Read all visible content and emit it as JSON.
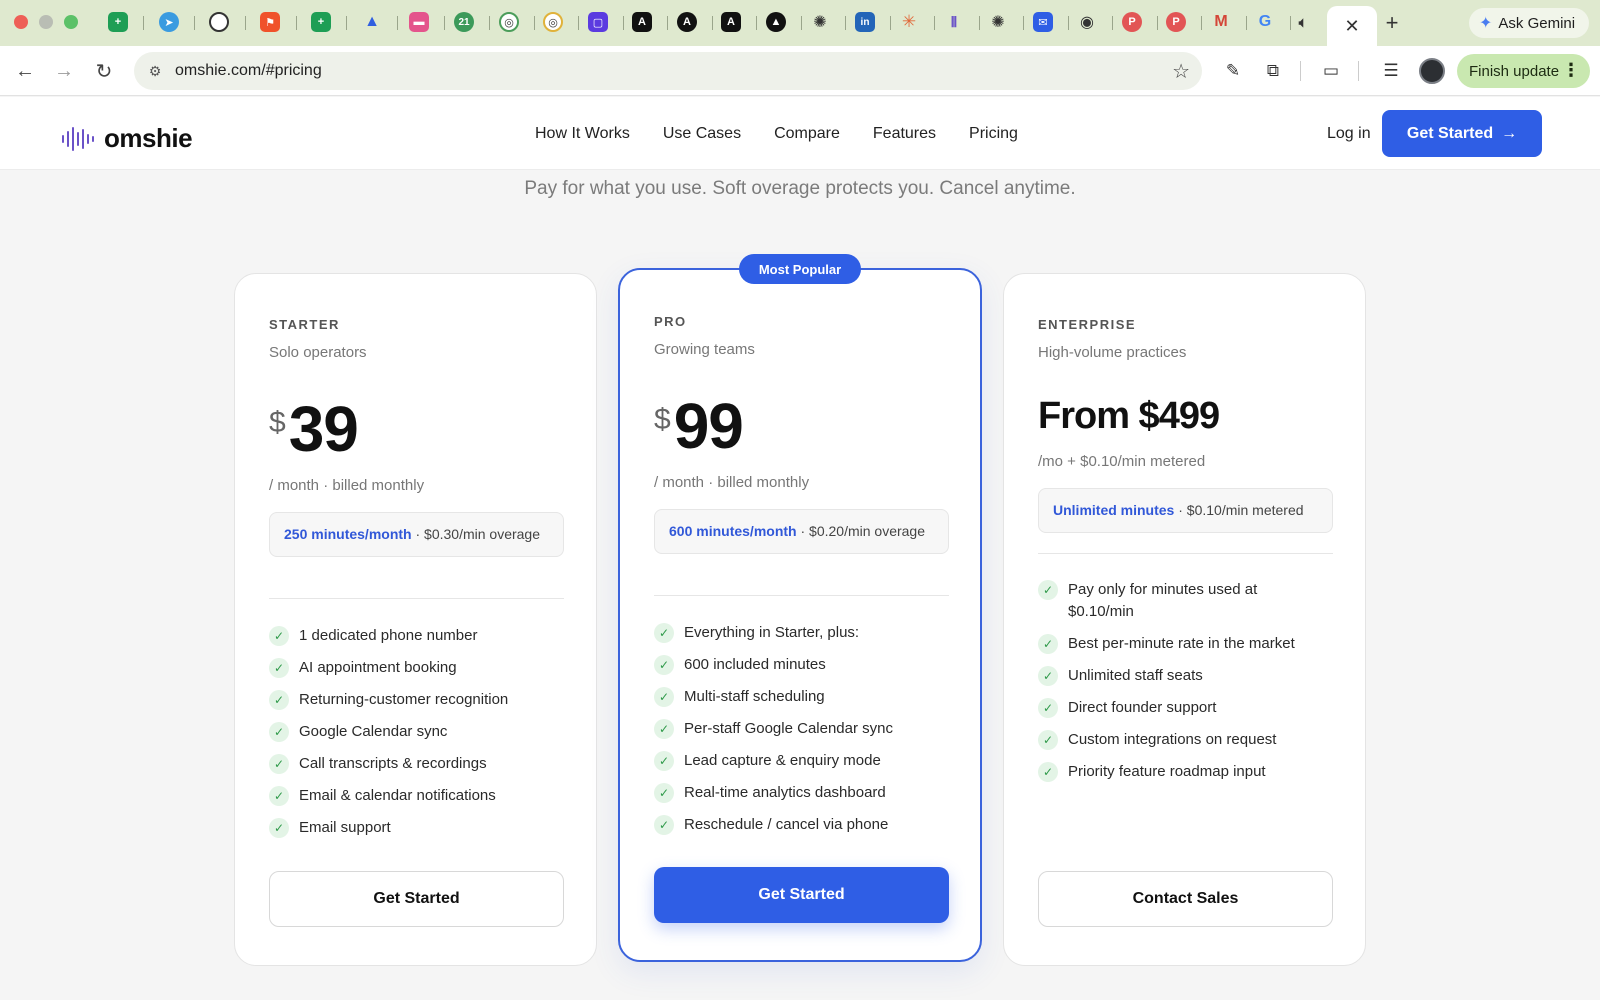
{
  "browser": {
    "active_tab_close": "✕",
    "new_tab": "+",
    "ask_gemini": "Ask Gemini",
    "url": "omshie.com/#pricing",
    "finish_update": "Finish update",
    "tab_badge": "21"
  },
  "site": {
    "logo": "omshie",
    "nav": [
      "How It Works",
      "Use Cases",
      "Compare",
      "Features",
      "Pricing"
    ],
    "login": "Log in",
    "cta": "Get Started",
    "subhead": "Pay for what you use. Soft overage protects you. Cancel anytime."
  },
  "plans": {
    "starter": {
      "tier": "STARTER",
      "tagline": "Solo operators",
      "currency": "$",
      "price": "39",
      "period": "/ month · billed monthly",
      "quota_hl": "250 minutes/month",
      "quota_rest": " · $0.30/min overage",
      "features": [
        "1 dedicated phone number",
        "AI appointment booking",
        "Returning-customer recognition",
        "Google Calendar sync",
        "Call transcripts & recordings",
        "Email & calendar notifications",
        "Email support"
      ],
      "cta": "Get Started"
    },
    "pro": {
      "badge": "Most Popular",
      "tier": "PRO",
      "tagline": "Growing teams",
      "currency": "$",
      "price": "99",
      "period": "/ month · billed monthly",
      "quota_hl": "600 minutes/month",
      "quota_rest": " · $0.20/min overage",
      "features": [
        "Everything in Starter, plus:",
        "600 included minutes",
        "Multi-staff scheduling",
        "Per-staff Google Calendar sync",
        "Lead capture & enquiry mode",
        "Real-time analytics dashboard",
        "Reschedule / cancel via phone"
      ],
      "cta": "Get Started"
    },
    "enterprise": {
      "tier": "ENTERPRISE",
      "tagline": "High-volume practices",
      "price": "From $499",
      "period": "/mo + $0.10/min metered",
      "quota_hl": "Unlimited minutes",
      "quota_rest": " · $0.10/min metered",
      "features": [
        "Pay only for minutes used at $0.10/min",
        "Best per-minute rate in the market",
        "Unlimited staff seats",
        "Direct founder support",
        "Custom integrations on request",
        "Priority feature roadmap input"
      ],
      "cta": "Contact Sales"
    }
  },
  "colors": {
    "brand_blue": "#2f5ee5",
    "check_green": "#2f9a4a",
    "tabbar": "#dfe9cf"
  }
}
